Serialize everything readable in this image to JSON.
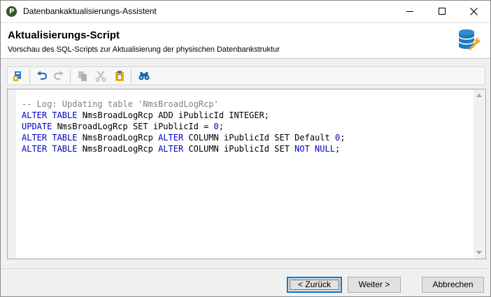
{
  "window": {
    "title": "Datenbankaktualisierungs-Assistent",
    "app_icon_glyph": "P"
  },
  "header": {
    "title": "Aktualisierungs-Script",
    "subtitle": "Vorschau des SQL-Scripts zur Aktualisierung der physischen Datenbankstruktur",
    "icon": "database-wrench-icon"
  },
  "toolbar": {
    "tools": [
      "save-script-icon",
      "undo-icon",
      "redo-icon",
      "copy-icon",
      "cut-icon",
      "paste-icon",
      "find-icon"
    ]
  },
  "editor": {
    "lines": [
      {
        "segments": [
          {
            "t": "-- Log: Updating table 'NmsBroadLogRcp'",
            "c": "cm"
          }
        ]
      },
      {
        "segments": [
          {
            "t": "ALTER TABLE",
            "c": "kw"
          },
          {
            "t": " NmsBroadLogRcp ADD iPublicId INTEGER;",
            "c": ""
          }
        ]
      },
      {
        "segments": [
          {
            "t": "UPDATE",
            "c": "kw"
          },
          {
            "t": " NmsBroadLogRcp SET iPublicId = ",
            "c": ""
          },
          {
            "t": "0",
            "c": "kw"
          },
          {
            "t": ";",
            "c": ""
          }
        ]
      },
      {
        "segments": [
          {
            "t": "ALTER TABLE",
            "c": "kw"
          },
          {
            "t": " NmsBroadLogRcp ",
            "c": ""
          },
          {
            "t": "ALTER",
            "c": "kw"
          },
          {
            "t": " COLUMN iPublicId SET Default ",
            "c": ""
          },
          {
            "t": "0",
            "c": "kw"
          },
          {
            "t": ";",
            "c": ""
          }
        ]
      },
      {
        "segments": [
          {
            "t": "ALTER TABLE",
            "c": "kw"
          },
          {
            "t": " NmsBroadLogRcp ",
            "c": ""
          },
          {
            "t": "ALTER",
            "c": "kw"
          },
          {
            "t": " COLUMN iPublicId SET ",
            "c": ""
          },
          {
            "t": "NOT NULL",
            "c": "kw"
          },
          {
            "t": ";",
            "c": ""
          }
        ]
      }
    ]
  },
  "buttons": {
    "back_label": "< Zurück",
    "next_label": "Weiter >",
    "cancel_label": "Abbrechen"
  },
  "colors": {
    "keyword": "#0000c8",
    "comment": "#808080",
    "focus": "#0078d7"
  }
}
